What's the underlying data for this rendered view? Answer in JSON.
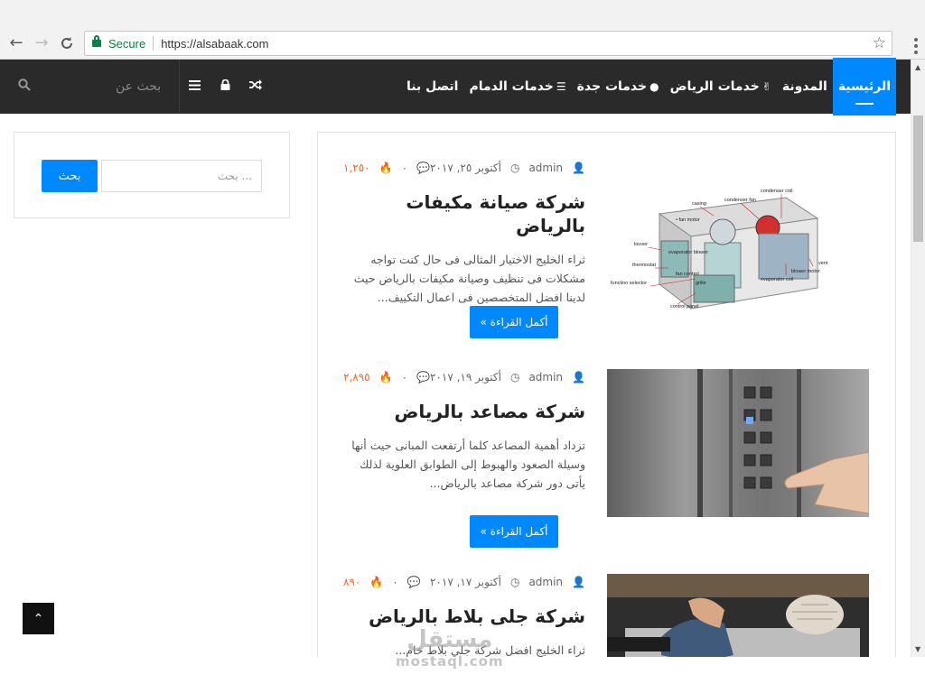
{
  "browser": {
    "secure_label": "Secure",
    "url": "https://alsabaak.com"
  },
  "nav": {
    "items": [
      {
        "label": "الرئيسية",
        "active": true
      },
      {
        "label": "المدونة",
        "icon": ""
      },
      {
        "label": "خدمات الرياض",
        "icon": "&"
      },
      {
        "label": "خدمات جدة",
        "icon": ""
      },
      {
        "label": "خدمات الدمام",
        "icon": "≡"
      },
      {
        "label": "اتصل بنا"
      }
    ],
    "search_placeholder": "بحث عن"
  },
  "sidebar": {
    "search_button": "بحث",
    "search_placeholder": "بحث ..."
  },
  "posts": [
    {
      "author": "admin",
      "date": "أكتوبر ٢٥, ٢٠١٧",
      "comments": "٠",
      "views": "١,٢٥٠",
      "title": "شركة صيانة مكيفات بالرياض",
      "excerpt": "ثراء الخليج الاختيار المثالى فى حال كنت تواجه مشكلات فى تنظيف وصيانة مكيفات بالرياض حيث لدينا افضل المتخصصين فى   اعمال التكييف...",
      "read_more": "أكمل القراءة »",
      "image": "ac-unit-diagram",
      "diagram_labels": [
        "condenser coil",
        "condenser fan",
        "casing",
        "fan motor",
        "louver",
        "evaporator blower",
        "thermostat",
        "fan control",
        "grille",
        "function selector",
        "control panel",
        "evaporator coil",
        "blower motor",
        "vent"
      ]
    },
    {
      "author": "admin",
      "date": "أكتوبر ١٩, ٢٠١٧",
      "comments": "٠",
      "views": "٢,٨٩٥",
      "title": "شركة مصاعد بالرياض",
      "excerpt": "تزداد أهمية المصاعد كلما أرتفعت المبانى حيث أنها وسيلة الصعود والهبوط إلى الطوابق العلوية لذلك يأتى دور شركة مصاعد بالرياض...",
      "read_more": "أكمل القراءة »",
      "image": "elevator-buttons"
    },
    {
      "author": "admin",
      "date": "أكتوبر ١٧, ٢٠١٧",
      "comments": "٠",
      "views": "٨٩٠",
      "title": "شركة جلى بلاط بالرياض",
      "excerpt": "ثراء الخليج افضل شركة جلي بلاط خام...",
      "image": "tile-polishing"
    }
  ],
  "watermark": {
    "arabic": "مستقل",
    "latin": "mostaql.com"
  }
}
